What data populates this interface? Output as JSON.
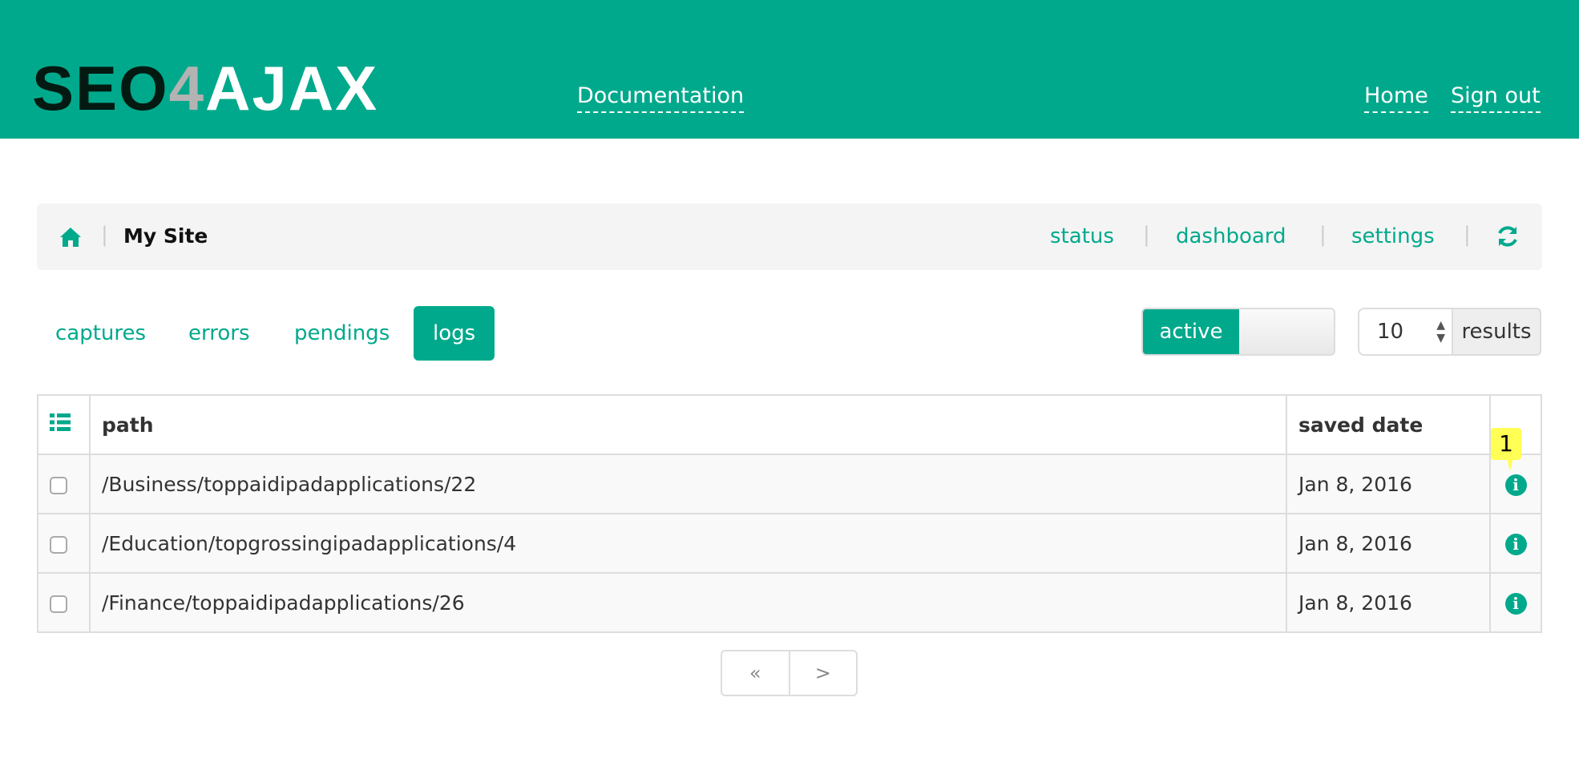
{
  "header": {
    "logo": "SEO4AJAX",
    "logo_parts": [
      "SEO",
      "4",
      "AJAX"
    ],
    "documentation": "Documentation",
    "home": "Home",
    "sign_out": "Sign out",
    "color": "#00a98c"
  },
  "breadcrumb": {
    "site": "My Site",
    "links": [
      "status",
      "dashboard",
      "settings"
    ],
    "home_icon": "home-icon",
    "refresh_icon": "refresh-icon"
  },
  "tabs": [
    {
      "label": "captures"
    },
    {
      "label": "errors"
    },
    {
      "label": "pendings"
    },
    {
      "label": "logs",
      "active": true
    }
  ],
  "filter": {
    "toggle_label": "active",
    "toggle_on": true,
    "page_size": "10",
    "results_label": "results"
  },
  "table": {
    "headers": [
      "path",
      "saved date"
    ],
    "rows": [
      {
        "path": "/Business/toppaidipadapplications/22",
        "date": "Jan 8, 2016"
      },
      {
        "path": "/Education/topgrossingipadapplications/4",
        "date": "Jan 8, 2016"
      },
      {
        "path": "/Finance/toppaidipadapplications/26",
        "date": "Jan 8, 2016"
      }
    ]
  },
  "annotation": "1",
  "pager": {
    "prev": "«",
    "next": ">"
  }
}
